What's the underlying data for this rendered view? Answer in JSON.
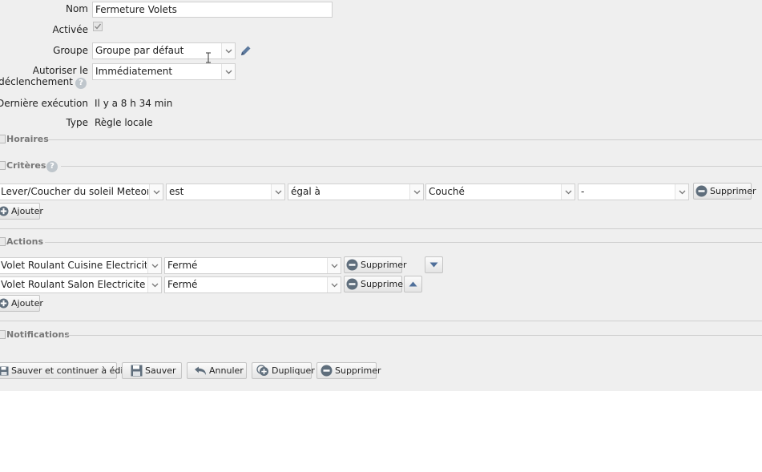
{
  "form": {
    "name_label": "Nom",
    "name_value": "Fermeture Volets",
    "active_label": "Activée",
    "group_label": "Groupe",
    "group_value": "Groupe par défaut",
    "retrigger_label_line1": "Autoriser le",
    "retrigger_label_line2": "edéclenchement",
    "retrigger_value": "Immédiatement",
    "last_exec_label": "Dernière exécution",
    "last_exec_value": "Il y a 8 h 34 min",
    "type_label": "Type",
    "type_value": "Règle locale"
  },
  "sections": {
    "schedules": "Horaires",
    "criteria": "Critères",
    "actions": "Actions",
    "notifications": "Notifications"
  },
  "criteria": {
    "row": {
      "device": "Lever/Coucher du soleil Meteorolo",
      "property": "est",
      "operator": "égal à",
      "value": "Couché",
      "extra": "-",
      "delete": "Supprimer"
    },
    "add": "Ajouter"
  },
  "actions": {
    "rows": [
      {
        "device": "Volet Roulant Cuisine Electricite",
        "state": "Fermé",
        "delete": "Supprimer"
      },
      {
        "device": "Volet Roulant Salon Electricite",
        "state": "Fermé",
        "delete": "Supprimer"
      }
    ],
    "add": "Ajouter"
  },
  "footer": {
    "save_continue": "Sauver et continuer à éditer",
    "save": "Sauver",
    "cancel": "Annuler",
    "duplicate": "Dupliquer",
    "delete": "Supprimer"
  },
  "colors": {
    "panel_bg": "#efefef",
    "icon_gray": "#6d7a86",
    "accent_blue": "#4f6f9a"
  }
}
